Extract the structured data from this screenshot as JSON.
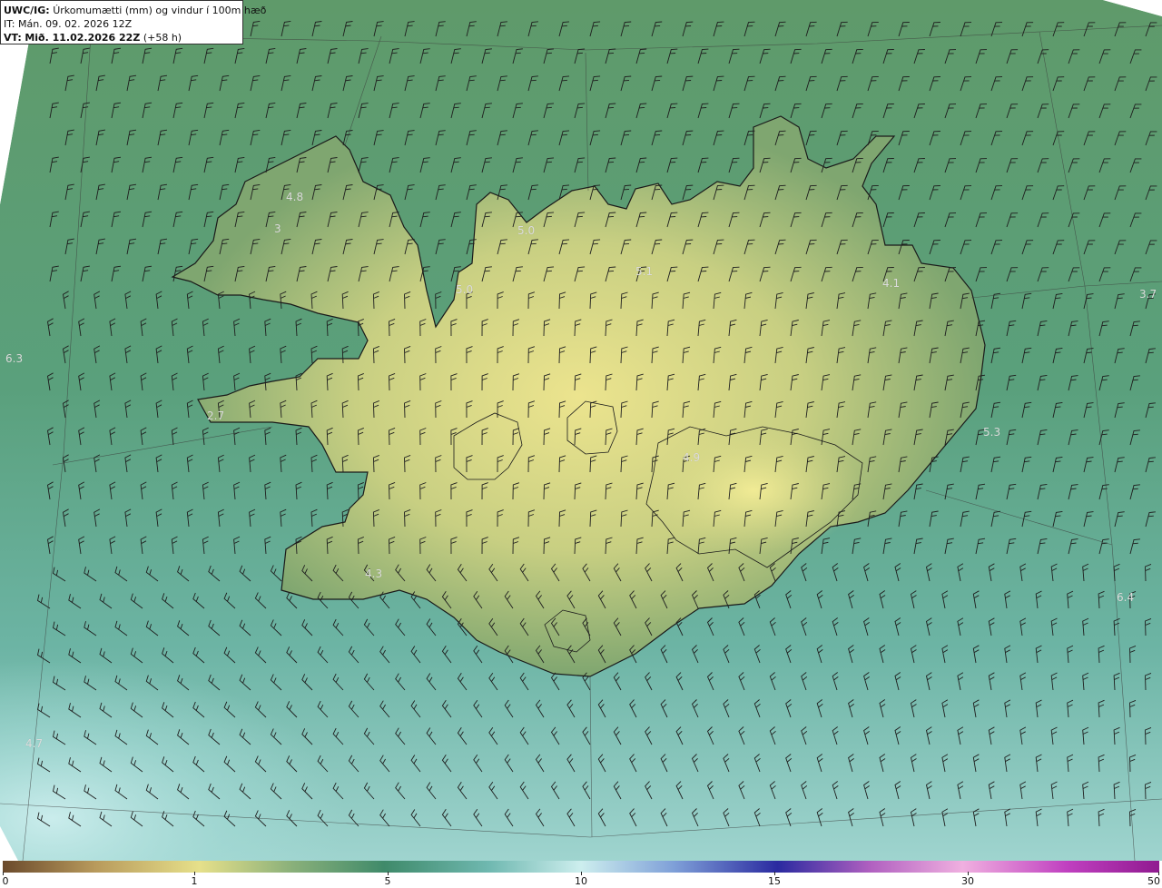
{
  "header": {
    "model_label": "UWC/IG:",
    "title": "Úrkomumætti (mm) og vindur í 100m hæð",
    "it_label": "IT:",
    "it_value": "Mán. 09. 02. 2026 12Z",
    "vt_label": "VT:",
    "vt_value": "Mið. 11.02.2026 22Z",
    "vt_offset": "(+58 h)"
  },
  "value_labels": [
    "4.8",
    "3",
    "5.0",
    "5.0",
    "5.1",
    "4.1",
    "3.7",
    "6.3",
    "2.7",
    "5.3",
    "6.4",
    "4.7",
    "4.9",
    "4.3"
  ],
  "colorbar": {
    "ticks": [
      "0",
      "1",
      "5",
      "10",
      "15",
      "30",
      "50"
    ],
    "colors": [
      "#6b4a2c",
      "#b89a5c",
      "#e6e08a",
      "#8ab07a",
      "#3f8a6a",
      "#6fb8b0",
      "#cdeeee",
      "#7fa0d8",
      "#2a2aa0",
      "#b060c0",
      "#f0b0e0",
      "#c040c0",
      "#901a90"
    ]
  },
  "legend_colors": {
    "ocean_deep": "#5aa58e",
    "ocean_light": "#bfe6e6",
    "land_low": "#7fa86c",
    "land_high": "#e4e08a"
  }
}
